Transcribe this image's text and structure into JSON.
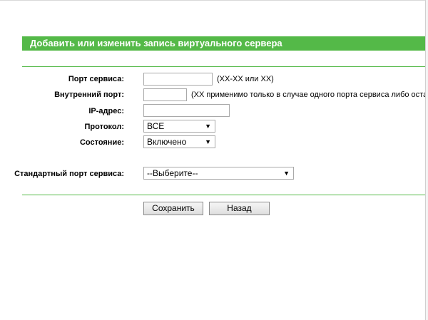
{
  "page": {
    "title": "Добавить или изменить запись виртуального сервера"
  },
  "form": {
    "service_port": {
      "label": "Порт сервиса:",
      "value": "",
      "hint": "(XX-XX или XX)"
    },
    "internal_port": {
      "label": "Внутренний порт:",
      "value": "",
      "hint": "(XX применимо только в случае одного порта сервиса либо оставьте"
    },
    "ip_address": {
      "label": "IP-адрес:",
      "value": ""
    },
    "protocol": {
      "label": "Протокол:",
      "selected": "ВСЕ"
    },
    "status": {
      "label": "Состояние:",
      "selected": "Включено"
    },
    "common_port": {
      "label": "Стандартный порт сервиса:",
      "selected": "--Выберите--"
    }
  },
  "buttons": {
    "save": "Сохранить",
    "back": "Назад"
  },
  "colors": {
    "accent": "#54b948"
  }
}
